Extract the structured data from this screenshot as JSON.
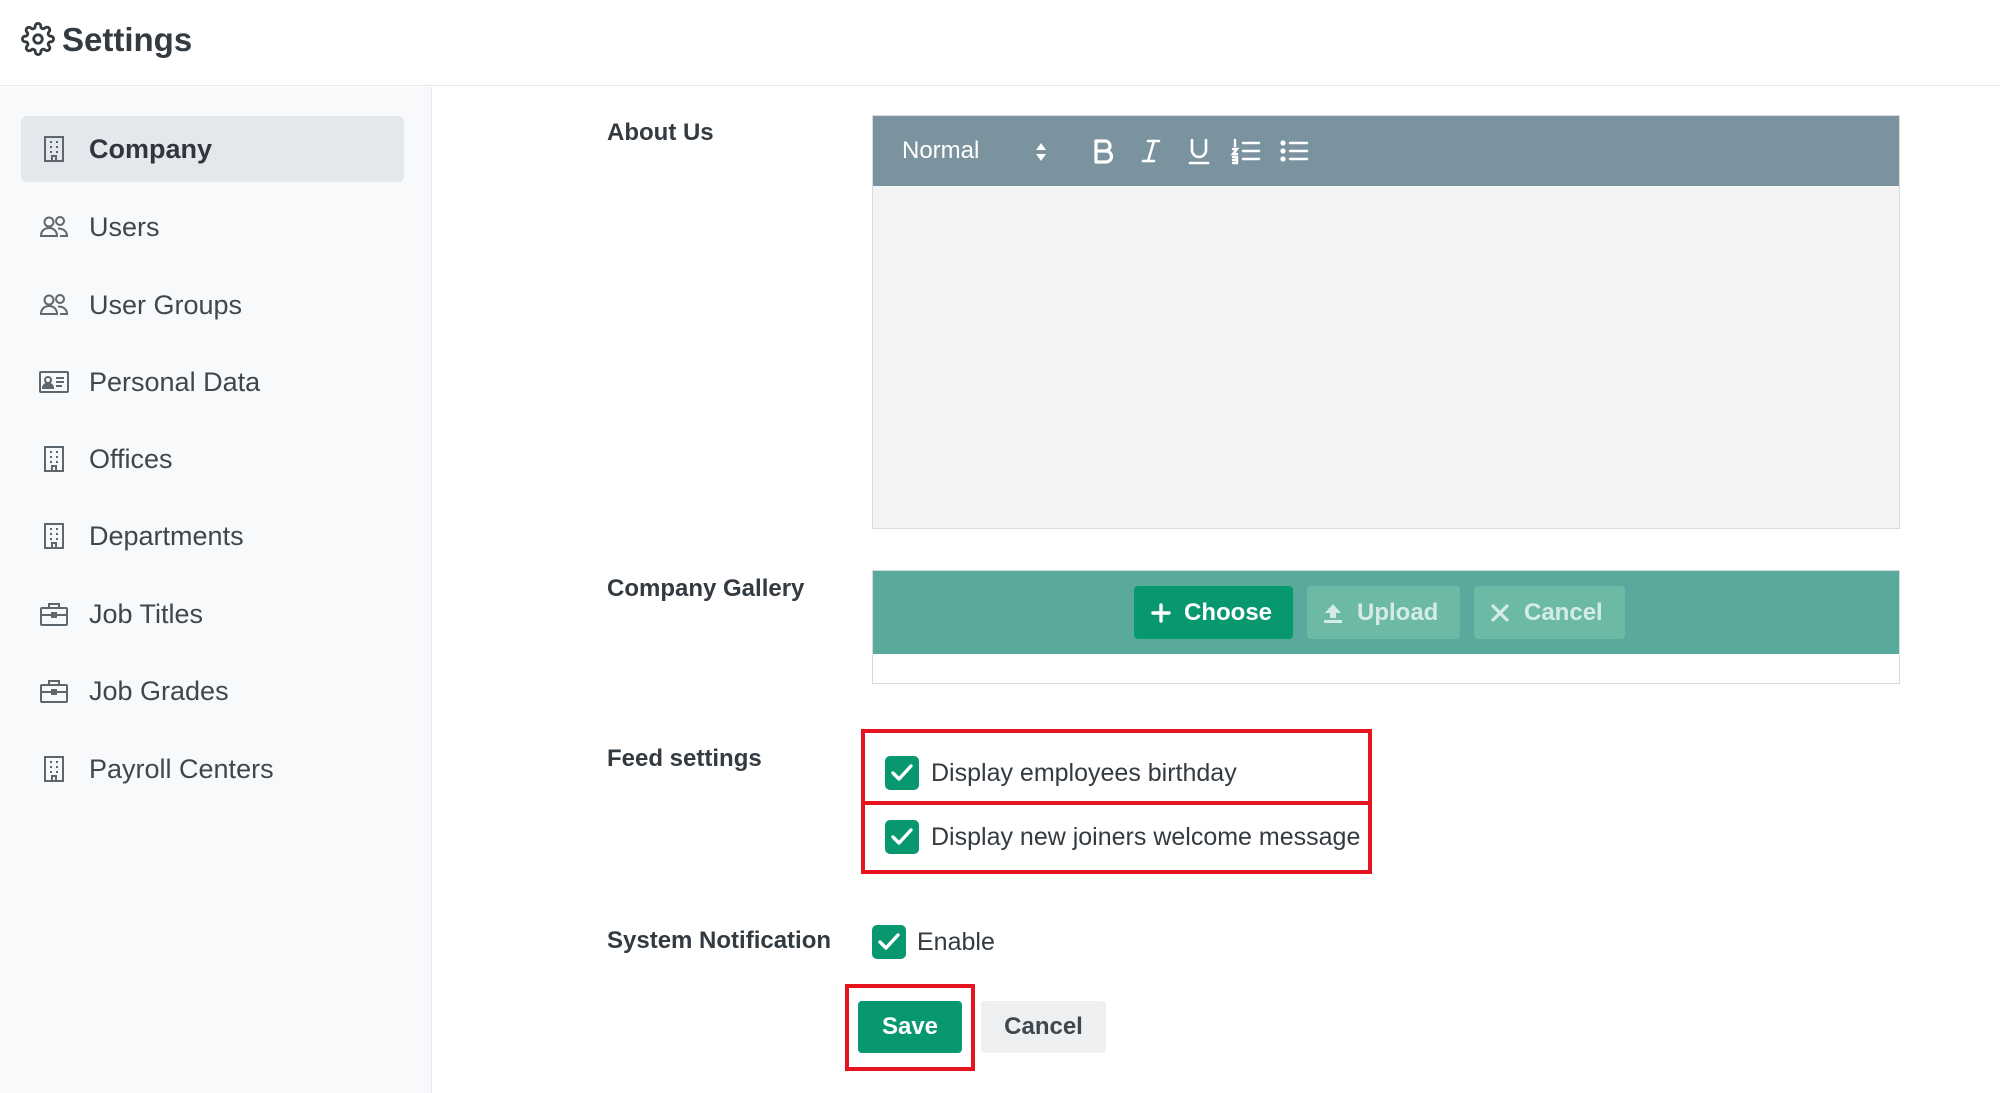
{
  "header": {
    "title": "Settings",
    "icon": "gear-icon"
  },
  "sidebar": {
    "items": [
      {
        "label": "Company",
        "icon": "building-icon",
        "active": true
      },
      {
        "label": "Users",
        "icon": "users-icon"
      },
      {
        "label": "User Groups",
        "icon": "users-icon"
      },
      {
        "label": "Personal Data",
        "icon": "id-card-icon"
      },
      {
        "label": "Offices",
        "icon": "building-icon"
      },
      {
        "label": "Departments",
        "icon": "building-icon"
      },
      {
        "label": "Job Titles",
        "icon": "briefcase-icon"
      },
      {
        "label": "Job Grades",
        "icon": "briefcase-icon"
      },
      {
        "label": "Payroll Centers",
        "icon": "building-icon"
      }
    ]
  },
  "about": {
    "label": "About Us",
    "format_value": "Normal",
    "toolbar": [
      "bold-icon",
      "italic-icon",
      "underline-icon",
      "ordered-list-icon",
      "bullet-list-icon"
    ]
  },
  "gallery": {
    "label": "Company Gallery",
    "choose_label": "Choose",
    "upload_label": "Upload",
    "cancel_label": "Cancel"
  },
  "feed": {
    "label": "Feed settings",
    "options": [
      {
        "label": "Display employees birthday",
        "checked": true
      },
      {
        "label": "Display new joiners welcome message",
        "checked": true
      }
    ]
  },
  "notification": {
    "label": "System Notification",
    "enable_label": "Enable",
    "checked": true
  },
  "actions": {
    "save_label": "Save",
    "cancel_label": "Cancel"
  },
  "colors": {
    "accent": "#07986f",
    "toolbar": "#7b939e",
    "upload_bar": "#5aa99d",
    "highlight": "#e5141f"
  }
}
